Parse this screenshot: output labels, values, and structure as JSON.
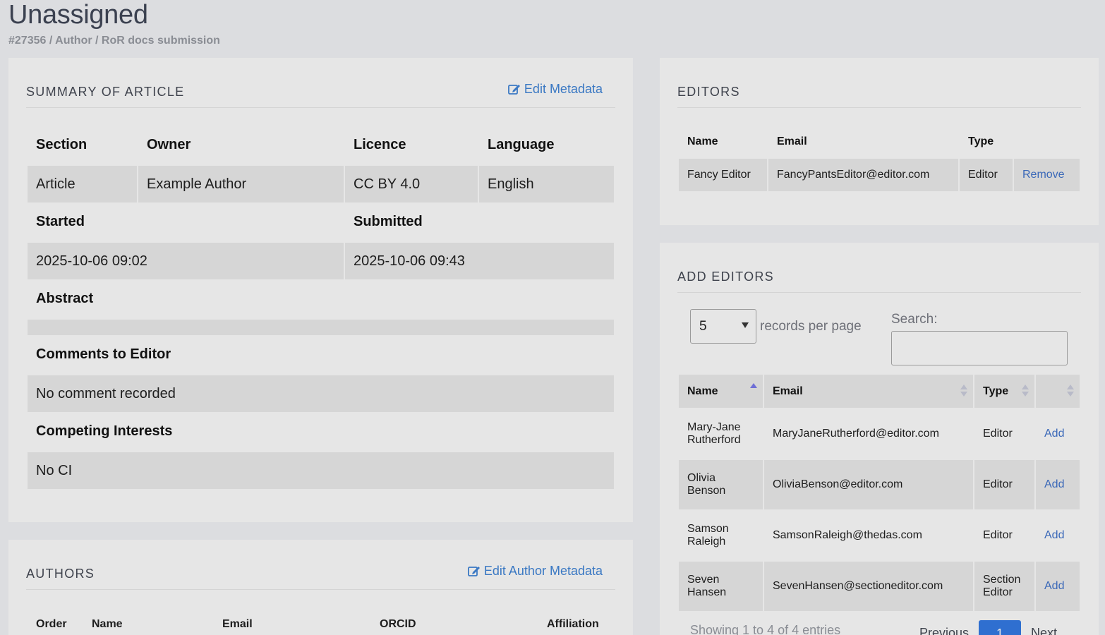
{
  "page": {
    "title": "Unassigned",
    "breadcrumb": "#27356 / Author / RoR docs submission"
  },
  "summary": {
    "title": "SUMMARY OF ARTICLE",
    "edit_link": "Edit Metadata",
    "edit_icon": "edit-icon",
    "headers": {
      "section": "Section",
      "owner": "Owner",
      "licence": "Licence",
      "language": "Language"
    },
    "values": {
      "section": "Article",
      "owner": "Example Author",
      "licence": "CC BY 4.0",
      "language": "English"
    },
    "started_label": "Started",
    "submitted_label": "Submitted",
    "started": "2025-10-06 09:02",
    "submitted": "2025-10-06 09:43",
    "abstract_label": "Abstract",
    "abstract": "",
    "comments_label": "Comments to Editor",
    "comments": "No comment recorded",
    "competing_label": "Competing Interests",
    "competing": "No CI"
  },
  "authors": {
    "title": "AUTHORS",
    "edit_link": "Edit Author Metadata",
    "columns": [
      "Order",
      "Name",
      "Email",
      "ORCID",
      "Affiliation"
    ]
  },
  "editors": {
    "title": "EDITORS",
    "columns": [
      "Name",
      "Email",
      "Type"
    ],
    "rows": [
      {
        "name": "Fancy Editor",
        "email": "FancyPantsEditor@editor.com",
        "type": "Editor",
        "action": "Remove"
      }
    ]
  },
  "add_editors": {
    "title": "ADD EDITORS",
    "per_page_value": "5",
    "per_page_label": "records per page",
    "search_label": "Search:",
    "search_value": "",
    "columns": [
      "Name",
      "Email",
      "Type"
    ],
    "rows": [
      {
        "name_1": "Mary-Jane",
        "name_2": "Rutherford",
        "email": "MaryJaneRutherford@editor.com",
        "type_1": "Editor",
        "type_2": "",
        "action": "Add"
      },
      {
        "name_1": "Olivia",
        "name_2": "Benson",
        "email": "OliviaBenson@editor.com",
        "type_1": "Editor",
        "type_2": "",
        "action": "Add"
      },
      {
        "name_1": "Samson",
        "name_2": "Raleigh",
        "email": "SamsonRaleigh@thedas.com",
        "type_1": "Editor",
        "type_2": "",
        "action": "Add"
      },
      {
        "name_1": "Seven",
        "name_2": "Hansen",
        "email": "SevenHansen@sectioneditor.com",
        "type_1": "Section",
        "type_2": "Editor",
        "action": "Add"
      }
    ],
    "info": "Showing 1 to 4 of 4 entries",
    "prev": "Previous",
    "page": "1",
    "next": "Next"
  },
  "colors": {
    "link": "#3a78c3",
    "panel": "#e6e6e6",
    "cell": "#d6d6d6",
    "page_button": "#2f6fd0"
  }
}
